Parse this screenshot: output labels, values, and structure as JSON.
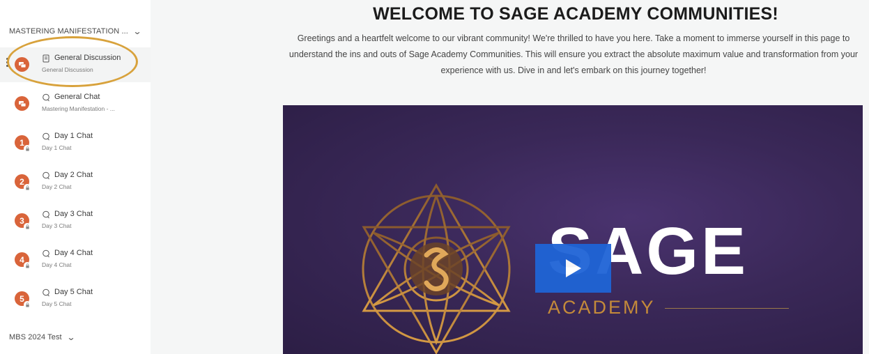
{
  "sidebar": {
    "section1": {
      "label": "MASTERING MANIFESTATION ..."
    },
    "section2": {
      "label": "MBS 2024 Test"
    },
    "channels": [
      {
        "title": "General Discussion",
        "subtitle": "General Discussion",
        "icon": "document-icon",
        "avatar": "chat-icon",
        "active": true
      },
      {
        "title": "General Chat",
        "subtitle": "Mastering Manifestation - ...",
        "icon": "chat-bubble-icon",
        "avatar": "chat-icon"
      },
      {
        "title": "Day 1 Chat",
        "subtitle": "Day 1 Chat",
        "icon": "chat-bubble-icon",
        "badge": "1",
        "locked": true
      },
      {
        "title": "Day 2 Chat",
        "subtitle": "Day 2 Chat",
        "icon": "chat-bubble-icon",
        "badge": "2",
        "locked": true
      },
      {
        "title": "Day 3 Chat",
        "subtitle": "Day 3 Chat",
        "icon": "chat-bubble-icon",
        "badge": "3",
        "locked": true
      },
      {
        "title": "Day 4 Chat",
        "subtitle": "Day 4 Chat",
        "icon": "chat-bubble-icon",
        "badge": "4",
        "locked": true
      },
      {
        "title": "Day 5 Chat",
        "subtitle": "Day 5 Chat",
        "icon": "chat-bubble-icon",
        "badge": "5",
        "locked": true
      }
    ]
  },
  "main": {
    "title": "WELCOME TO SAGE ACADEMY COMMUNITIES!",
    "body": "Greetings and a heartfelt welcome to our vibrant community! We're thrilled to have you here. Take a moment to immerse yourself in this page to understand the ins and outs of Sage Academy Communities. This will ensure you extract the absolute maximum value and transformation from your experience with us. Dive in and let's embark on this journey together!",
    "video": {
      "logo_word": "SAGE",
      "logo_sub": "ACADEMY",
      "play_icon": "play-icon"
    }
  },
  "colors": {
    "accent_orange": "#d9643a",
    "highlight_ring": "#d8a23c",
    "video_bg": "#3a2858",
    "play_button": "#1f64d6",
    "academy_gold": "#c48a3a"
  }
}
